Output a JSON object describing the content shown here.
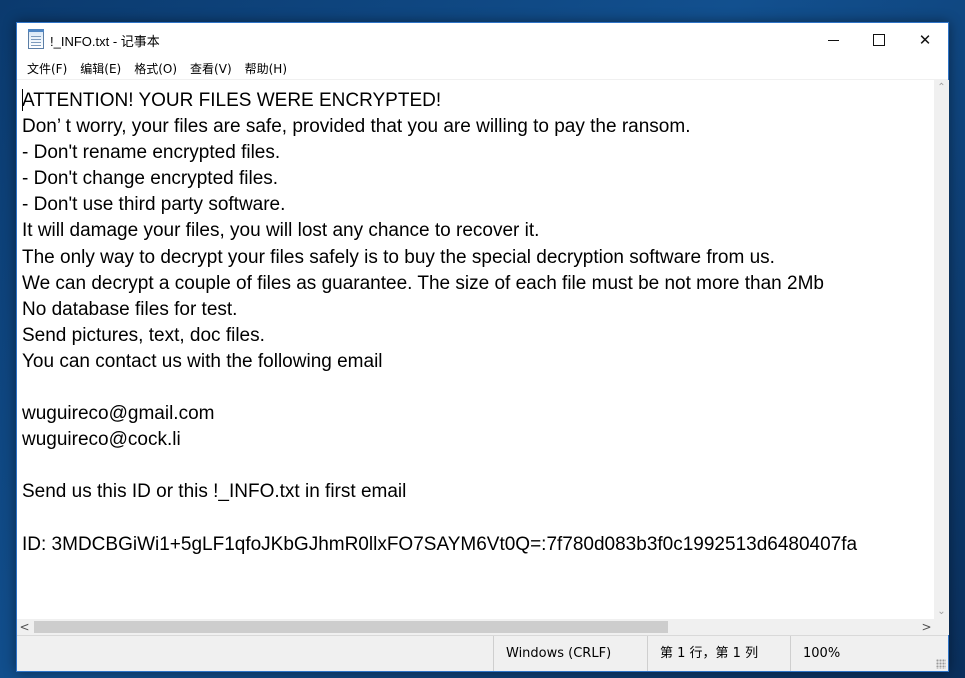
{
  "window": {
    "title": "!_INFO.txt - 记事本",
    "controls": {
      "minimize": "minimize",
      "maximize": "maximize",
      "close": "✕"
    }
  },
  "menubar": {
    "items": [
      {
        "label": "文件(F)"
      },
      {
        "label": "编辑(E)"
      },
      {
        "label": "格式(O)"
      },
      {
        "label": "查看(V)"
      },
      {
        "label": "帮助(H)"
      }
    ]
  },
  "editor": {
    "text": "ATTENTION! YOUR FILES WERE ENCRYPTED!\nDon’ t worry, your files are safe, provided that you are willing to pay the ransom.\n- Don't rename encrypted files.\n- Don't change encrypted files.\n- Don't use third party software.\nIt will damage your files, you will lost any chance to recover it.\nThe only way to decrypt your files safely is to buy the special decryption software from us.\nWe can decrypt a couple of files as guarantee. The size of each file must be not more than 2Mb\nNo database files for test.\nSend pictures, text, doc files.\nYou can contact us with the following email\n\nwuguireco@gmail.com\nwuguireco@cock.li\n\nSend us this ID or this !_INFO.txt in first email\n\nID: 3MDCBGiWi1+5gLF1qfoJKbGJhmR0llxFO7SAYM6Vt0Q=:7f780d083b3f0c1992513d6480407fa"
  },
  "scrollbars": {
    "up_arrow": "⌃",
    "down_arrow": "⌄",
    "left_arrow": "<",
    "right_arrow": ">"
  },
  "statusbar": {
    "line_ending": "Windows (CRLF)",
    "position": "第 1 行，第 1 列",
    "zoom": "100%"
  }
}
